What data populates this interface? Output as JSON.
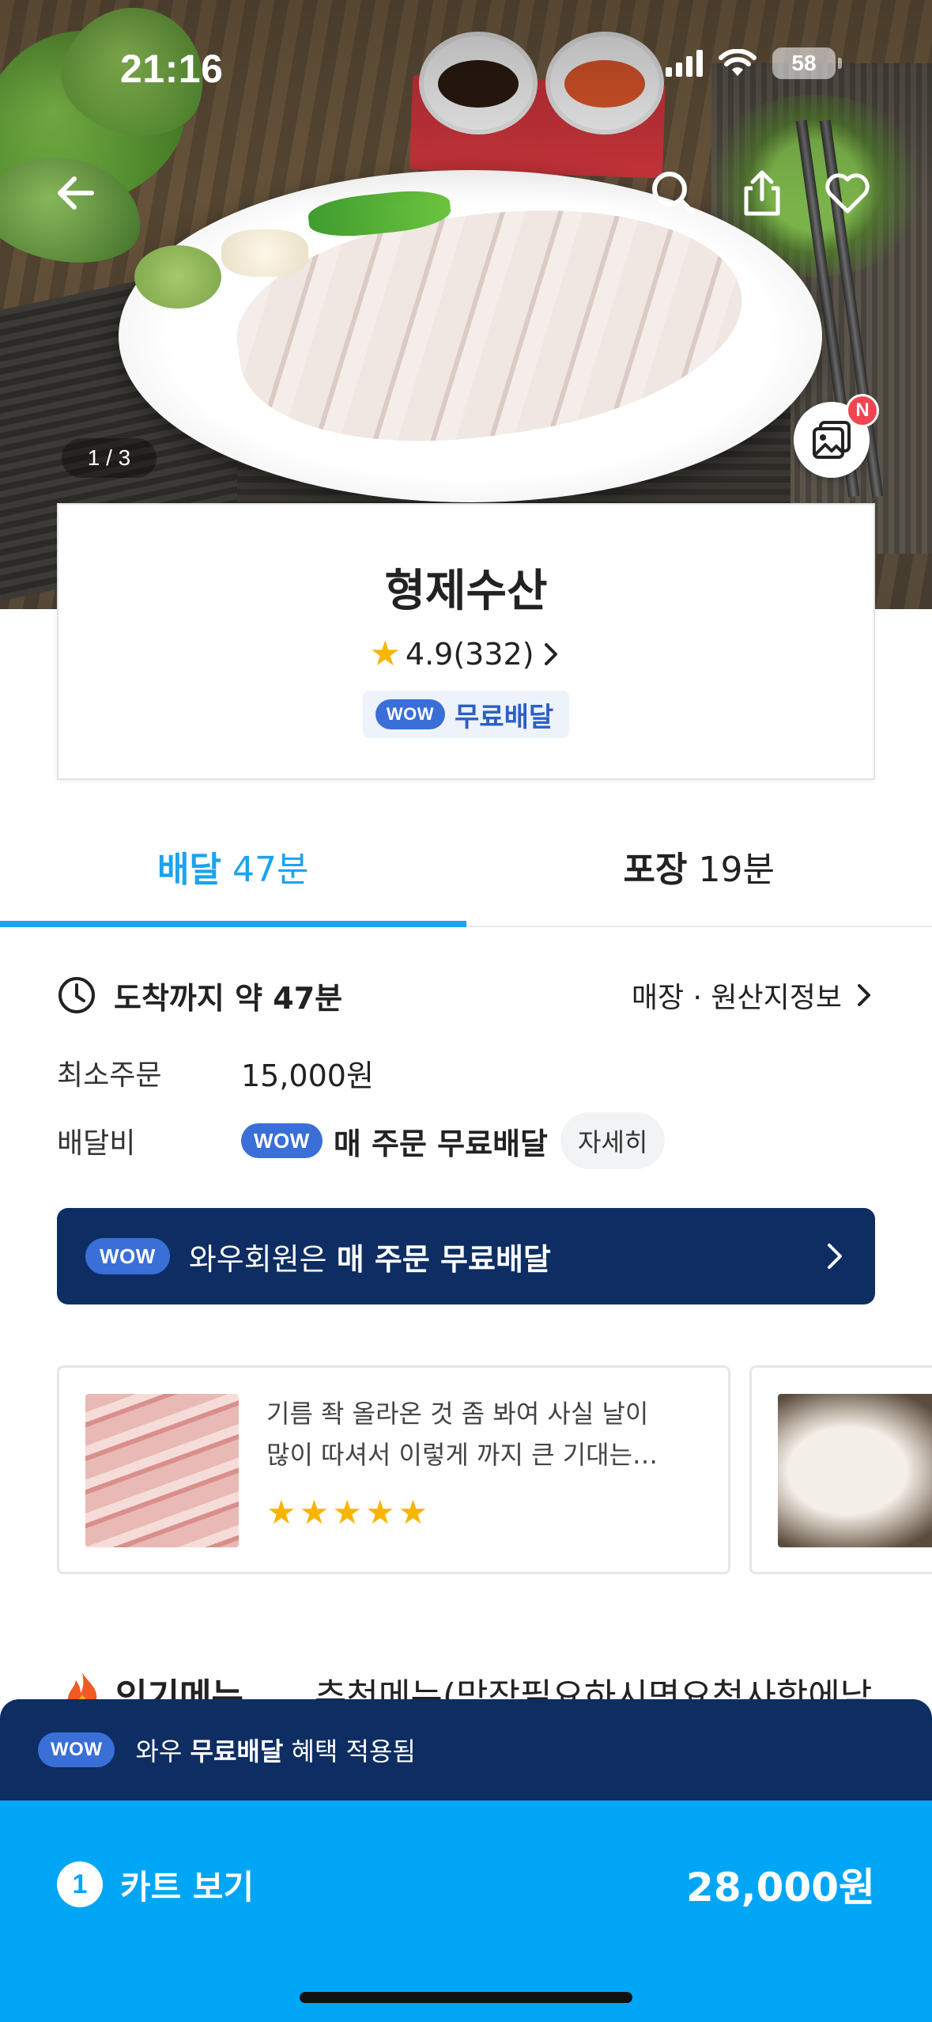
{
  "status_bar": {
    "time": "21:16",
    "battery": "58"
  },
  "hero": {
    "page_indicator": "1 / 3",
    "new_badge": "N"
  },
  "store": {
    "name": "형제수산",
    "rating": "4.9(332)",
    "wow_label": "WOW",
    "free_delivery": "무료배달"
  },
  "tabs": [
    {
      "label": "배달",
      "time": "47분",
      "active": true
    },
    {
      "label": "포장",
      "time": "19분",
      "active": false
    }
  ],
  "info": {
    "arrival": "도착까지 약 47분",
    "origin_link": "매장 · 원산지정보",
    "min_order_label": "최소주문",
    "min_order_value": "15,000원",
    "delivery_fee_label": "배달비",
    "delivery_fee_wow": "WOW",
    "delivery_fee_value": "매 주문 무료배달",
    "detail_button": "자세히"
  },
  "wow_banner": {
    "badge": "WOW",
    "prefix": "와우회원은 ",
    "bold": "매 주문 무료배달"
  },
  "reviews": [
    {
      "line1": "기름 좍 올라온 것 좀 봐여 사실 날이",
      "line2": "많이 따셔서 이렇게 까지 큰 기대는…",
      "stars": 5
    }
  ],
  "menu_categories": {
    "popular": "인기메뉴",
    "recommended": "추천메뉴(막장필요하시면요청사항에남"
  },
  "bottom": {
    "wow_badge": "WOW",
    "applied_prefix": "와우 ",
    "applied_bold": "무료배달",
    "applied_suffix": " 혜택 적용됨",
    "cart_count": "1",
    "cart_label": "카트 보기",
    "cart_total": "28,000원"
  },
  "colors": {
    "accent": "#1aa3f0",
    "cart": "#00a6f6",
    "navy": "#0d2d63",
    "wow_blue": "#3a6fd8",
    "star": "#f7b500"
  }
}
